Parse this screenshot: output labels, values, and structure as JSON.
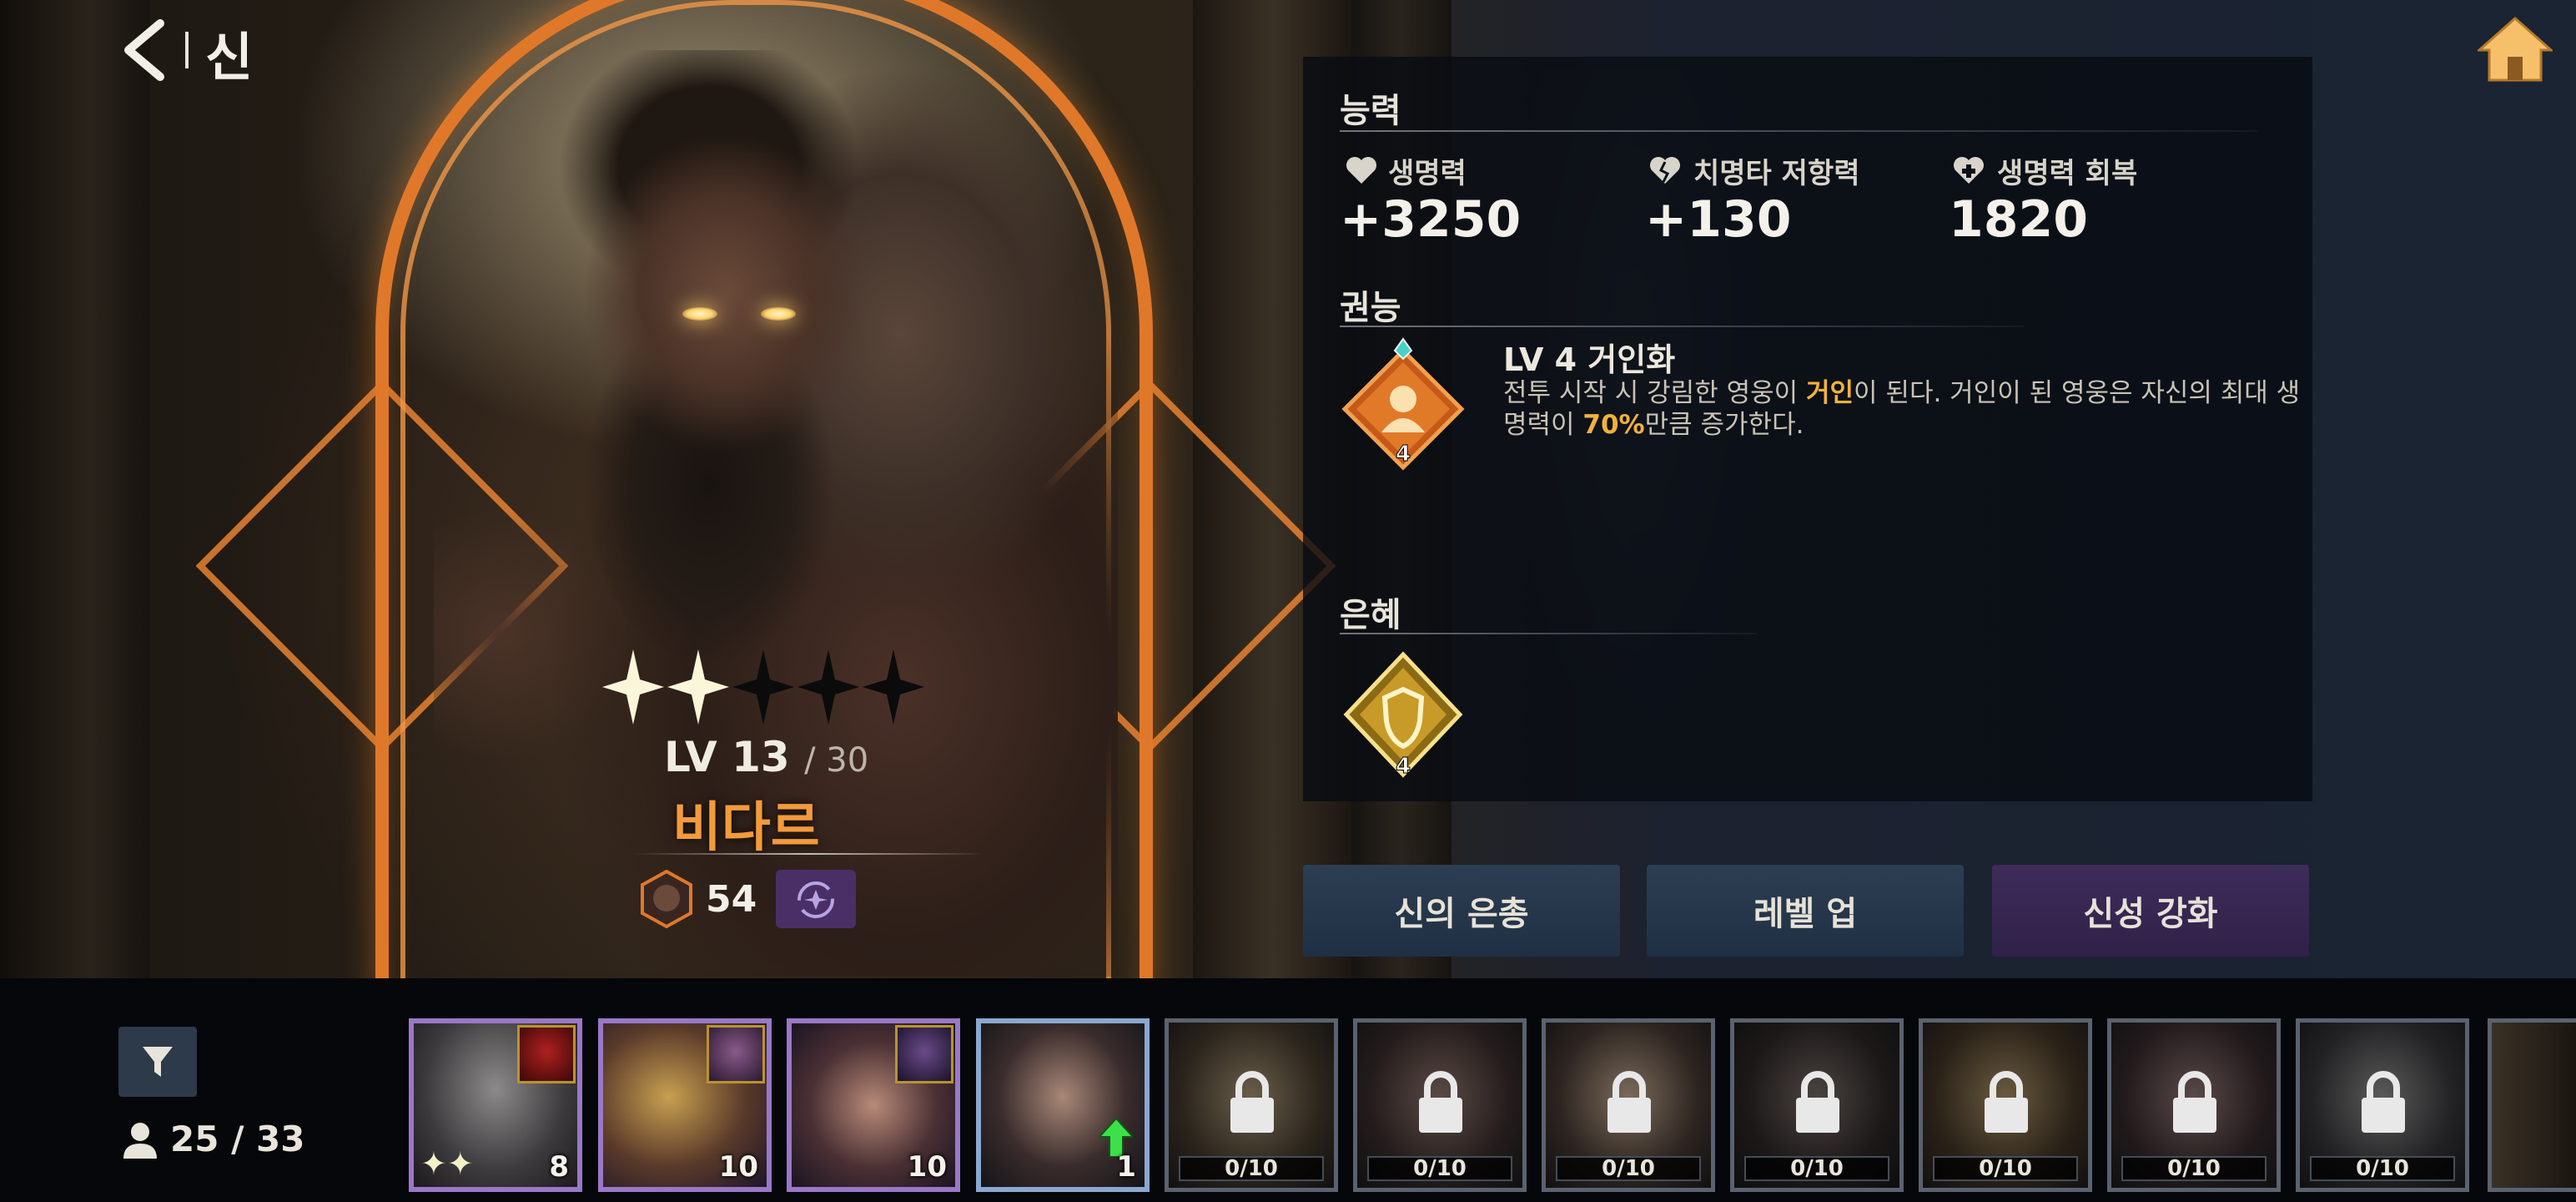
{
  "nav": {
    "title": "신"
  },
  "hero": {
    "stars_filled": 2,
    "stars_total": 5,
    "level_prefix": "LV",
    "level": "13",
    "level_max": "/ 30",
    "name": "비다르",
    "badge_value": "54"
  },
  "ability": {
    "title": "능력",
    "stats": [
      {
        "label": "생명력",
        "value": "+3250",
        "icon": "heart-icon"
      },
      {
        "label": "치명타 저항력",
        "value": "+130",
        "icon": "broken-heart-shield-icon"
      },
      {
        "label": "생명력 회복",
        "value": "1820",
        "icon": "heart-plus-icon"
      }
    ]
  },
  "authority": {
    "title": "권능",
    "skill_level": "4",
    "skill_name": "LV 4 거인화",
    "desc_1": "전투 시작 시 강림한 영웅이 ",
    "desc_hl_1": "거인",
    "desc_2": "이 된다. 거인이 된 영웅은 자신의 최대 생명력이 ",
    "desc_hl_2": "70%",
    "desc_3": "만큼 증가한다."
  },
  "grace": {
    "title": "은혜",
    "level": "4"
  },
  "buttons": {
    "grace": "신의 은총",
    "level_up": "레벨 업",
    "divinity": "신성 강화"
  },
  "roster": {
    "count": "25 / 33",
    "cards": [
      {
        "level": "8",
        "locked": false,
        "stars": "✦✦"
      },
      {
        "level": "10",
        "locked": false
      },
      {
        "level": "10",
        "locked": false
      },
      {
        "level": "1",
        "locked": false,
        "upgrade": true
      },
      {
        "progress": "0/10",
        "locked": true
      },
      {
        "progress": "0/10",
        "locked": true
      },
      {
        "progress": "0/10",
        "locked": true
      },
      {
        "progress": "0/10",
        "locked": true
      },
      {
        "progress": "0/10",
        "locked": true
      },
      {
        "progress": "0/10",
        "locked": true
      },
      {
        "progress": "0/10",
        "locked": true
      }
    ]
  },
  "colors": {
    "accent_orange": "#f39a3c",
    "highlight": "#f2b13d",
    "frame_orange": "#e0782a",
    "button_blue": "#2d3e52",
    "button_purple": "#3e2c5a"
  }
}
